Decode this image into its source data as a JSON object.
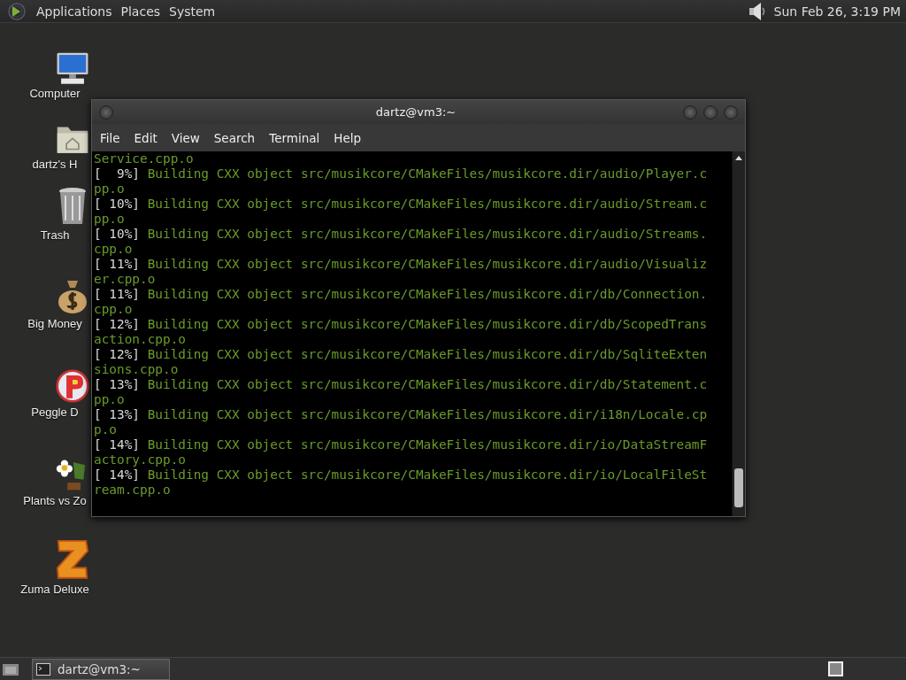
{
  "top_panel": {
    "menus": [
      "Applications",
      "Places",
      "System"
    ],
    "clock": "Sun Feb 26,  3:19 PM"
  },
  "desktop_icons": [
    {
      "kind": "computer",
      "label": "Computer"
    },
    {
      "kind": "home",
      "label": "dartz's H"
    },
    {
      "kind": "trash",
      "label": "Trash"
    },
    {
      "kind": "moneybag",
      "label": "Big Money"
    },
    {
      "kind": "peggle",
      "label": "Peggle D"
    },
    {
      "kind": "plant",
      "label": "Plants vs Zo"
    },
    {
      "kind": "zuma",
      "label": "Zuma Deluxe"
    }
  ],
  "window": {
    "title": "dartz@vm3:~",
    "menu": [
      "File",
      "Edit",
      "View",
      "Search",
      "Terminal",
      "Help"
    ],
    "lines": [
      {
        "kind": "cont",
        "text": "Service.cpp.o"
      },
      {
        "kind": "progress",
        "percent": "[  9%]",
        "text": "Building CXX object src/musikcore/CMakeFiles/musikcore.dir/audio/Player.c"
      },
      {
        "kind": "cont",
        "text": "pp.o"
      },
      {
        "kind": "progress",
        "percent": "[ 10%]",
        "text": "Building CXX object src/musikcore/CMakeFiles/musikcore.dir/audio/Stream.c"
      },
      {
        "kind": "cont",
        "text": "pp.o"
      },
      {
        "kind": "progress",
        "percent": "[ 10%]",
        "text": "Building CXX object src/musikcore/CMakeFiles/musikcore.dir/audio/Streams."
      },
      {
        "kind": "cont",
        "text": "cpp.o"
      },
      {
        "kind": "progress",
        "percent": "[ 11%]",
        "text": "Building CXX object src/musikcore/CMakeFiles/musikcore.dir/audio/Visualiz"
      },
      {
        "kind": "cont",
        "text": "er.cpp.o"
      },
      {
        "kind": "progress",
        "percent": "[ 11%]",
        "text": "Building CXX object src/musikcore/CMakeFiles/musikcore.dir/db/Connection."
      },
      {
        "kind": "cont",
        "text": "cpp.o"
      },
      {
        "kind": "progress",
        "percent": "[ 12%]",
        "text": "Building CXX object src/musikcore/CMakeFiles/musikcore.dir/db/ScopedTrans"
      },
      {
        "kind": "cont",
        "text": "action.cpp.o"
      },
      {
        "kind": "progress",
        "percent": "[ 12%]",
        "text": "Building CXX object src/musikcore/CMakeFiles/musikcore.dir/db/SqliteExten"
      },
      {
        "kind": "cont",
        "text": "sions.cpp.o"
      },
      {
        "kind": "progress",
        "percent": "[ 13%]",
        "text": "Building CXX object src/musikcore/CMakeFiles/musikcore.dir/db/Statement.c"
      },
      {
        "kind": "cont",
        "text": "pp.o"
      },
      {
        "kind": "progress",
        "percent": "[ 13%]",
        "text": "Building CXX object src/musikcore/CMakeFiles/musikcore.dir/i18n/Locale.cp"
      },
      {
        "kind": "cont",
        "text": "p.o"
      },
      {
        "kind": "progress",
        "percent": "[ 14%]",
        "text": "Building CXX object src/musikcore/CMakeFiles/musikcore.dir/io/DataStreamF"
      },
      {
        "kind": "cont",
        "text": "actory.cpp.o"
      },
      {
        "kind": "progress",
        "percent": "[ 14%]",
        "text": "Building CXX object src/musikcore/CMakeFiles/musikcore.dir/io/LocalFileSt"
      },
      {
        "kind": "cont",
        "text": "ream.cpp.o"
      }
    ]
  },
  "taskbar": {
    "tasks": [
      {
        "label": "dartz@vm3:~",
        "selected": true
      }
    ]
  }
}
